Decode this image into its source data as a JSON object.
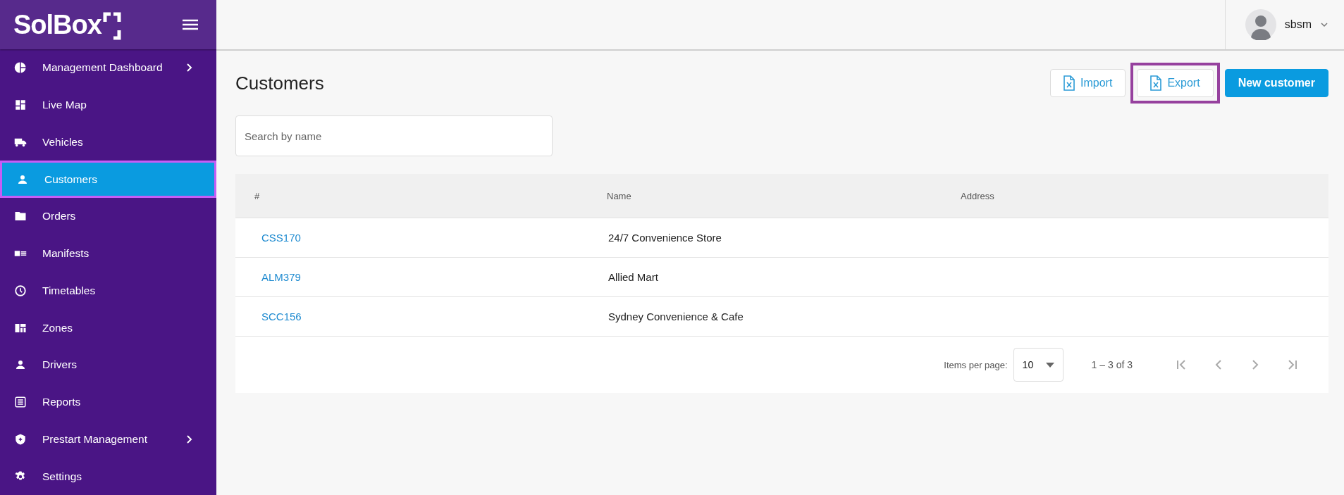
{
  "logo": {
    "text": "SolBox"
  },
  "sidebar": {
    "items": [
      {
        "label": "Management Dashboard",
        "kind": "pie",
        "expandable": true,
        "selected": false,
        "highlighted": false
      },
      {
        "label": "Live Map",
        "kind": "dashboard",
        "expandable": false,
        "selected": false,
        "highlighted": false
      },
      {
        "label": "Vehicles",
        "kind": "truck",
        "expandable": false,
        "selected": false,
        "highlighted": false
      },
      {
        "label": "Customers",
        "kind": "person",
        "expandable": false,
        "selected": true,
        "highlighted": true
      },
      {
        "label": "Orders",
        "kind": "folder",
        "expandable": false,
        "selected": false,
        "highlighted": false
      },
      {
        "label": "Manifests",
        "kind": "card",
        "expandable": false,
        "selected": false,
        "highlighted": false
      },
      {
        "label": "Timetables",
        "kind": "clock",
        "expandable": false,
        "selected": false,
        "highlighted": false
      },
      {
        "label": "Zones",
        "kind": "grid",
        "expandable": false,
        "selected": false,
        "highlighted": false
      },
      {
        "label": "Drivers",
        "kind": "person",
        "expandable": false,
        "selected": false,
        "highlighted": false
      },
      {
        "label": "Reports",
        "kind": "list",
        "expandable": false,
        "selected": false,
        "highlighted": false
      },
      {
        "label": "Prestart Management",
        "kind": "shield",
        "expandable": true,
        "selected": false,
        "highlighted": false
      },
      {
        "label": "Settings",
        "kind": "gear",
        "expandable": false,
        "selected": false,
        "highlighted": false
      }
    ]
  },
  "user": {
    "name": "sbsm"
  },
  "page": {
    "title": "Customers"
  },
  "actions": [
    {
      "label": "Import",
      "kind": "file",
      "highlighted": false
    },
    {
      "label": "Export",
      "kind": "file",
      "highlighted": true
    },
    {
      "label": "New customer",
      "kind": "primary",
      "highlighted": false
    }
  ],
  "search": {
    "placeholder": "Search by name"
  },
  "table": {
    "columns": [
      "#",
      "Name",
      "Address"
    ],
    "rows": [
      {
        "id": "CSS170",
        "name": "24/7 Convenience Store"
      },
      {
        "id": "ALM379",
        "name": "Allied Mart"
      },
      {
        "id": "SCC156",
        "name": "Sydney Convenience & Cafe"
      }
    ]
  },
  "pagination": {
    "items_label": "Items per page:",
    "page_size": "10",
    "range": "1 – 3 of 3"
  }
}
